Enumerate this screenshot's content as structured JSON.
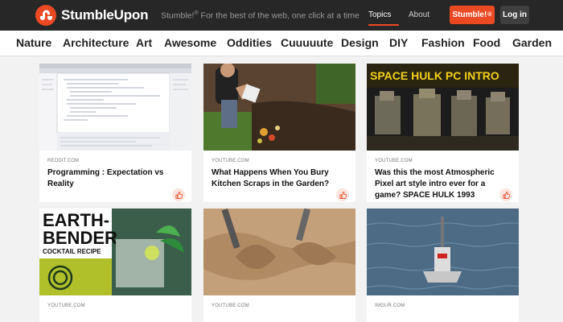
{
  "header": {
    "logo_text": "StumbleUpon",
    "tagline_prefix": "Stumble!",
    "tagline_reg": "®",
    "tagline_rest": "For the best of the web, one click at a time",
    "nav_topics": "Topics",
    "nav_about": "About",
    "stumble_button": "Stumble!",
    "stumble_reg": "®",
    "login_button": "Log in",
    "accent_color": "#eb4924"
  },
  "categories": [
    "Nature",
    "Architecture",
    "Art",
    "Awesome",
    "Oddities",
    "Cuuuuute",
    "Design",
    "DIY",
    "Fashion",
    "Food",
    "Garden"
  ],
  "cards": [
    {
      "source": "REDDIT.COM",
      "title": "Programming : Expectation vs Reality"
    },
    {
      "source": "YOUTUBE.COM",
      "title": "What Happens When You Bury Kitchen Scraps in the Garden?"
    },
    {
      "source": "YOUTUBE.COM",
      "title": "Was this the most Atmospheric Pixel art style intro ever for a game? SPACE HULK 1993",
      "thumb_text": "SPACE HULK PC INTRO"
    },
    {
      "source": "YOUTUBE.COM",
      "title": "",
      "thumb_text_1": "EARTH-",
      "thumb_text_2": "BENDER",
      "thumb_text_3": "COCKTAIL RECIPE"
    },
    {
      "source": "YOUTUBE.COM",
      "title": ""
    },
    {
      "source": "IMGUR.COM",
      "title": ""
    }
  ]
}
